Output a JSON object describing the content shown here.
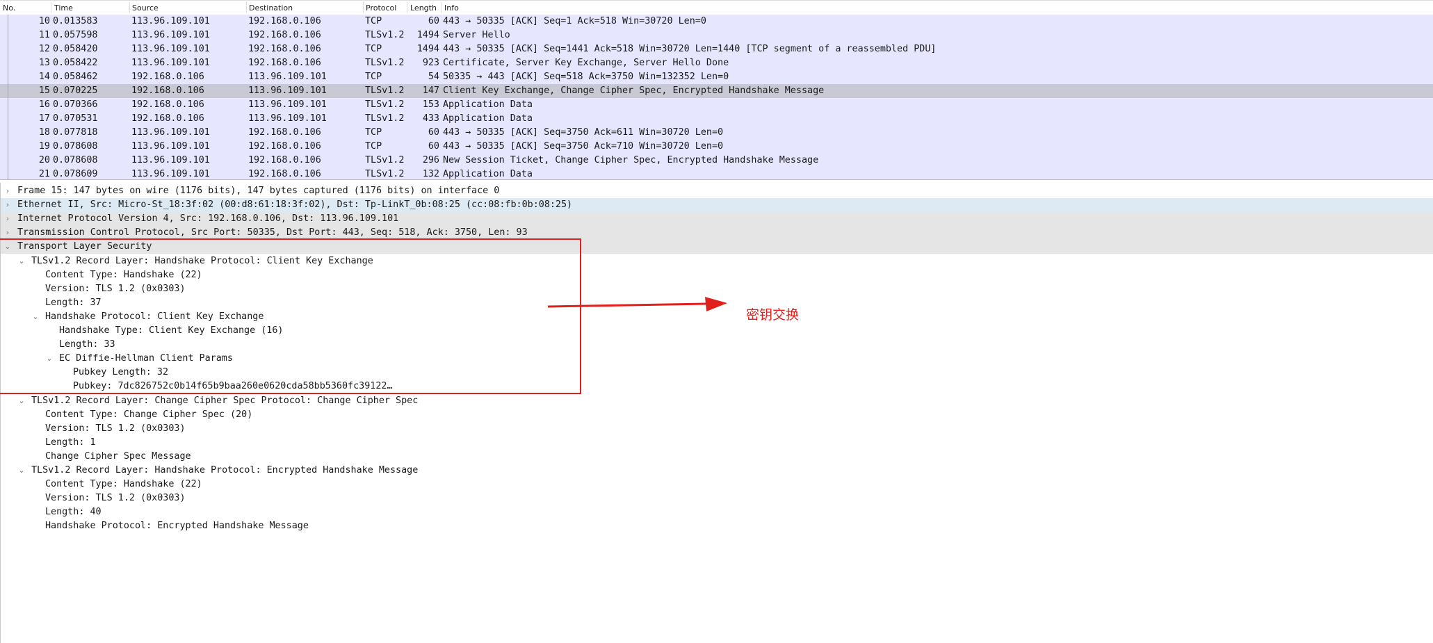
{
  "packet_list": {
    "columns": {
      "no": "No.",
      "time": "Time",
      "source": "Source",
      "destination": "Destination",
      "protocol": "Protocol",
      "length": "Length",
      "info": "Info"
    },
    "rows": [
      {
        "no": "10",
        "time": "0.013583",
        "source": "113.96.109.101",
        "destination": "192.168.0.106",
        "protocol": "TCP",
        "length": "60",
        "info": "443 → 50335 [ACK] Seq=1 Ack=518 Win=30720 Len=0"
      },
      {
        "no": "11",
        "time": "0.057598",
        "source": "113.96.109.101",
        "destination": "192.168.0.106",
        "protocol": "TLSv1.2",
        "length": "1494",
        "info": "Server Hello"
      },
      {
        "no": "12",
        "time": "0.058420",
        "source": "113.96.109.101",
        "destination": "192.168.0.106",
        "protocol": "TCP",
        "length": "1494",
        "info": "443 → 50335 [ACK] Seq=1441 Ack=518 Win=30720 Len=1440 [TCP segment of a reassembled PDU]"
      },
      {
        "no": "13",
        "time": "0.058422",
        "source": "113.96.109.101",
        "destination": "192.168.0.106",
        "protocol": "TLSv1.2",
        "length": "923",
        "info": "Certificate, Server Key Exchange, Server Hello Done"
      },
      {
        "no": "14",
        "time": "0.058462",
        "source": "192.168.0.106",
        "destination": "113.96.109.101",
        "protocol": "TCP",
        "length": "54",
        "info": "50335 → 443 [ACK] Seq=518 Ack=3750 Win=132352 Len=0"
      },
      {
        "no": "15",
        "time": "0.070225",
        "source": "192.168.0.106",
        "destination": "113.96.109.101",
        "protocol": "TLSv1.2",
        "length": "147",
        "info": "Client Key Exchange, Change Cipher Spec, Encrypted Handshake Message",
        "selected": true
      },
      {
        "no": "16",
        "time": "0.070366",
        "source": "192.168.0.106",
        "destination": "113.96.109.101",
        "protocol": "TLSv1.2",
        "length": "153",
        "info": "Application Data"
      },
      {
        "no": "17",
        "time": "0.070531",
        "source": "192.168.0.106",
        "destination": "113.96.109.101",
        "protocol": "TLSv1.2",
        "length": "433",
        "info": "Application Data"
      },
      {
        "no": "18",
        "time": "0.077818",
        "source": "113.96.109.101",
        "destination": "192.168.0.106",
        "protocol": "TCP",
        "length": "60",
        "info": "443 → 50335 [ACK] Seq=3750 Ack=611 Win=30720 Len=0"
      },
      {
        "no": "19",
        "time": "0.078608",
        "source": "113.96.109.101",
        "destination": "192.168.0.106",
        "protocol": "TCP",
        "length": "60",
        "info": "443 → 50335 [ACK] Seq=3750 Ack=710 Win=30720 Len=0"
      },
      {
        "no": "20",
        "time": "0.078608",
        "source": "113.96.109.101",
        "destination": "192.168.0.106",
        "protocol": "TLSv1.2",
        "length": "296",
        "info": "New Session Ticket, Change Cipher Spec, Encrypted Handshake Message"
      },
      {
        "no": "21",
        "time": "0.078609",
        "source": "113.96.109.101",
        "destination": "192.168.0.106",
        "protocol": "TLSv1.2",
        "length": "132",
        "info": "Application Data"
      }
    ]
  },
  "details": {
    "lines": [
      {
        "level": 0,
        "expander": "collapsed",
        "text": "Frame 15: 147 bytes on wire (1176 bits), 147 bytes captured (1176 bits) on interface 0",
        "style": "plain"
      },
      {
        "level": 0,
        "expander": "collapsed",
        "text": "Ethernet II, Src: Micro-St_18:3f:02 (00:d8:61:18:3f:02), Dst: Tp-LinkT_0b:08:25 (cc:08:fb:0b:08:25)",
        "style": "selected"
      },
      {
        "level": 0,
        "expander": "collapsed",
        "text": "Internet Protocol Version 4, Src: 192.168.0.106, Dst: 113.96.109.101",
        "style": "shaded"
      },
      {
        "level": 0,
        "expander": "collapsed",
        "text": "Transmission Control Protocol, Src Port: 50335, Dst Port: 443, Seq: 518, Ack: 3750, Len: 93",
        "style": "shaded"
      },
      {
        "level": 0,
        "expander": "expanded",
        "text": "Transport Layer Security",
        "style": "shaded"
      },
      {
        "level": 1,
        "expander": "expanded",
        "text": "TLSv1.2 Record Layer: Handshake Protocol: Client Key Exchange",
        "style": "plain"
      },
      {
        "level": 2,
        "expander": "none",
        "text": "Content Type: Handshake (22)",
        "style": "plain"
      },
      {
        "level": 2,
        "expander": "none",
        "text": "Version: TLS 1.2 (0x0303)",
        "style": "plain"
      },
      {
        "level": 2,
        "expander": "none",
        "text": "Length: 37",
        "style": "plain"
      },
      {
        "level": 2,
        "expander": "expanded",
        "text": "Handshake Protocol: Client Key Exchange",
        "style": "plain"
      },
      {
        "level": 3,
        "expander": "none",
        "text": "Handshake Type: Client Key Exchange (16)",
        "style": "plain"
      },
      {
        "level": 3,
        "expander": "none",
        "text": "Length: 33",
        "style": "plain"
      },
      {
        "level": 3,
        "expander": "expanded",
        "text": "EC Diffie-Hellman Client Params",
        "style": "plain"
      },
      {
        "level": 4,
        "expander": "none",
        "text": "Pubkey Length: 32",
        "style": "plain"
      },
      {
        "level": 4,
        "expander": "none",
        "text": "Pubkey: 7dc826752c0b14f65b9baa260e0620cda58bb5360fc39122…",
        "style": "plain"
      },
      {
        "level": 1,
        "expander": "expanded",
        "text": "TLSv1.2 Record Layer: Change Cipher Spec Protocol: Change Cipher Spec",
        "style": "plain"
      },
      {
        "level": 2,
        "expander": "none",
        "text": "Content Type: Change Cipher Spec (20)",
        "style": "plain"
      },
      {
        "level": 2,
        "expander": "none",
        "text": "Version: TLS 1.2 (0x0303)",
        "style": "plain"
      },
      {
        "level": 2,
        "expander": "none",
        "text": "Length: 1",
        "style": "plain"
      },
      {
        "level": 2,
        "expander": "none",
        "text": "Change Cipher Spec Message",
        "style": "plain"
      },
      {
        "level": 1,
        "expander": "expanded",
        "text": "TLSv1.2 Record Layer: Handshake Protocol: Encrypted Handshake Message",
        "style": "plain"
      },
      {
        "level": 2,
        "expander": "none",
        "text": "Content Type: Handshake (22)",
        "style": "plain"
      },
      {
        "level": 2,
        "expander": "none",
        "text": "Version: TLS 1.2 (0x0303)",
        "style": "plain"
      },
      {
        "level": 2,
        "expander": "none",
        "text": "Length: 40",
        "style": "plain"
      },
      {
        "level": 2,
        "expander": "none",
        "text": "Handshake Protocol: Encrypted Handshake Message",
        "style": "plain"
      }
    ]
  },
  "annotation": {
    "label": "密钥交换",
    "color": "#e0201c"
  },
  "colors": {
    "row_bg": "#e7e6ff",
    "row_selected_bg": "#c9c9d6",
    "detail_shaded_bg": "#e5e5e5",
    "detail_selected_bg": "#dde9f3"
  }
}
